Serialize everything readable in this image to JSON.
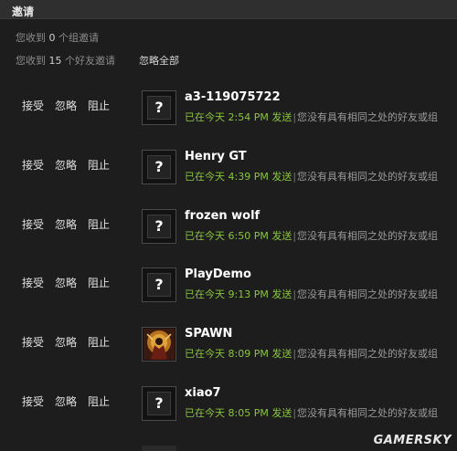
{
  "header": {
    "title": "邀请"
  },
  "summary": {
    "groups": {
      "prefix": "您收到",
      "count": "0",
      "suffix": "个组邀请"
    },
    "friends": {
      "prefix": "您收到",
      "count": "15",
      "suffix": "个好友邀请"
    },
    "ignore_all": "忽略全部"
  },
  "actions": {
    "accept": "接受",
    "ignore": "忽略",
    "block": "阻止"
  },
  "invites": [
    {
      "name": "a3-119075722",
      "status": "已在今天",
      "time": "2:54 PM",
      "sent": "发送",
      "note": "您没有具有相同之处的好友或组",
      "avatar": "question-mark-icon"
    },
    {
      "name": "Henry GT",
      "status": "已在今天",
      "time": "4:39 PM",
      "sent": "发送",
      "note": "您没有具有相同之处的好友或组",
      "avatar": "question-mark-icon"
    },
    {
      "name": "frozen wolf",
      "status": "已在今天",
      "time": "6:50 PM",
      "sent": "发送",
      "note": "您没有具有相同之处的好友或组",
      "avatar": "question-mark-icon"
    },
    {
      "name": "PlayDemo",
      "status": "已在今天",
      "time": "9:13 PM",
      "sent": "发送",
      "note": "您没有具有相同之处的好友或组",
      "avatar": "question-mark-icon"
    },
    {
      "name": "SPAWN",
      "status": "已在今天",
      "time": "8:09 PM",
      "sent": "发送",
      "note": "您没有具有相同之处的好友或组",
      "avatar": "spawn-avatar-image"
    },
    {
      "name": "xiao7",
      "status": "已在今天",
      "time": "8:05 PM",
      "sent": "发送",
      "note": "您没有具有相同之处的好友或组",
      "avatar": "question-mark-icon"
    }
  ],
  "avatar_placeholder": "?",
  "watermark": "GAMERSKY",
  "colors": {
    "background": "#1d1d1d",
    "status_green": "#8bc53f",
    "header": "#2f2f2f"
  }
}
